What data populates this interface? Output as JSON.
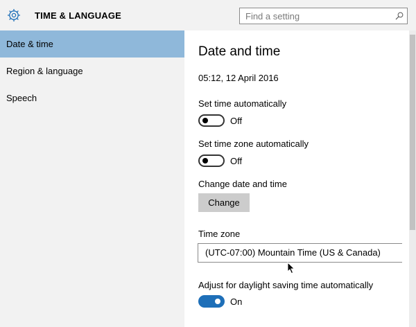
{
  "header": {
    "title": "TIME & LANGUAGE",
    "search_placeholder": "Find a setting"
  },
  "sidebar": {
    "items": [
      {
        "label": "Date & time",
        "active": true
      },
      {
        "label": "Region & language",
        "active": false
      },
      {
        "label": "Speech",
        "active": false
      }
    ]
  },
  "main": {
    "title": "Date and time",
    "current_datetime": "05:12, 12 April 2016",
    "set_time_auto": {
      "label": "Set time automatically",
      "state": "Off"
    },
    "set_timezone_auto": {
      "label": "Set time zone automatically",
      "state": "Off"
    },
    "change_datetime": {
      "label": "Change date and time",
      "button": "Change"
    },
    "timezone": {
      "label": "Time zone",
      "value": "(UTC-07:00) Mountain Time (US & Canada)"
    },
    "daylight_saving": {
      "label": "Adjust for daylight saving time automatically",
      "state": "On"
    }
  },
  "colors": {
    "accent": "#1e6fb8",
    "sidebar_selected": "#8fb8da",
    "panel_background": "#f2f2f2"
  },
  "icons": [
    "gear-icon",
    "search-icon",
    "mouse-cursor-icon"
  ]
}
